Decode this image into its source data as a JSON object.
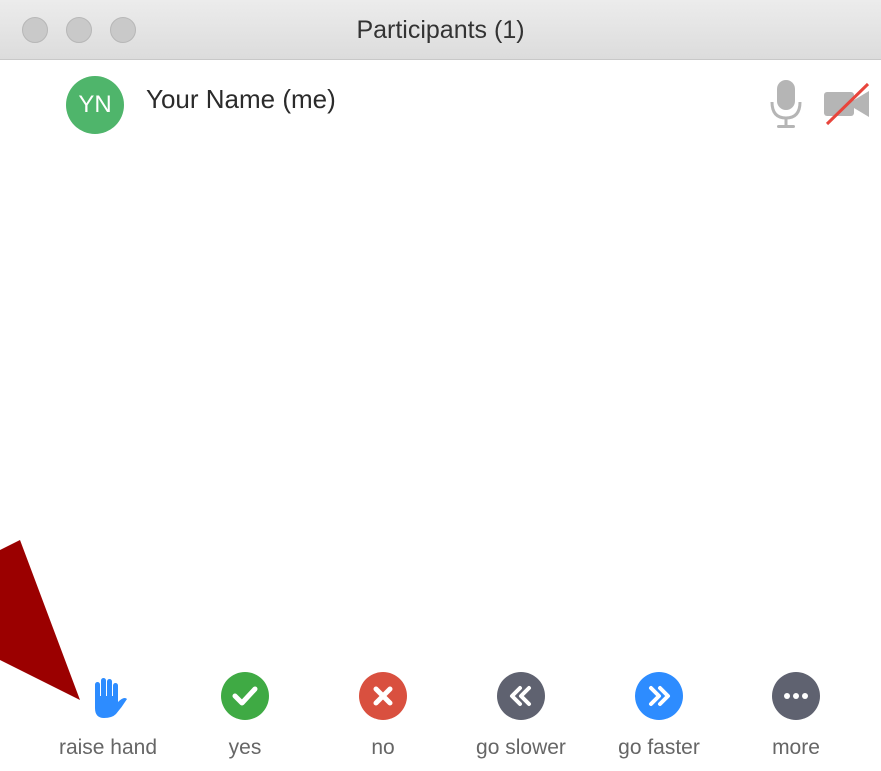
{
  "window": {
    "title": "Participants (1)"
  },
  "participant": {
    "initials": "YN",
    "name": "Your Name (me)",
    "avatar_color": "#4fb56b"
  },
  "reactions": {
    "raise_hand": "raise hand",
    "yes": "yes",
    "no": "no",
    "go_slower": "go slower",
    "go_faster": "go faster",
    "more": "more"
  },
  "colors": {
    "hand_blue": "#2d8cff",
    "yes_green": "#3faa44",
    "no_red": "#d9503f",
    "slower_gray": "#5f6270",
    "faster_blue": "#2d8cff",
    "more_gray": "#5f6270",
    "arrow_red": "#9b0000",
    "video_off_red": "#e8453c"
  },
  "icons": {
    "mic": "microphone-icon",
    "video": "video-off-icon",
    "hand": "raised-hand-icon",
    "yes": "check-icon",
    "no": "x-icon",
    "slower": "double-chevron-left-icon",
    "faster": "double-chevron-right-icon",
    "more": "ellipsis-icon"
  }
}
